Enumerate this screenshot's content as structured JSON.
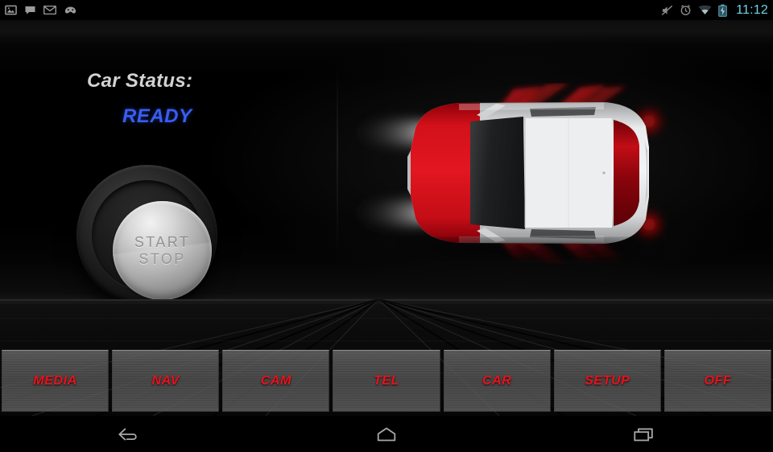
{
  "status_bar": {
    "left_icons": [
      {
        "name": "screenshot-image-icon",
        "label": "screenshot"
      },
      {
        "name": "chat-bubble-icon",
        "label": "message"
      },
      {
        "name": "email-envelope-icon",
        "label": "email"
      },
      {
        "name": "cyanogenmod-head-icon",
        "label": "cyanogenmod"
      }
    ],
    "right_icons": [
      {
        "name": "volume-mute-icon",
        "label": "silent mode"
      },
      {
        "name": "alarm-clock-icon",
        "label": "alarm set"
      },
      {
        "name": "wifi-icon",
        "label": "wifi"
      },
      {
        "name": "battery-charging-icon",
        "label": "battery charging"
      }
    ],
    "clock": "11:12",
    "clock_color": "#6fd5e8"
  },
  "main": {
    "car_status_label": "Car Status:",
    "car_status_value": "READY",
    "car_status_value_color": "#3a5cf0",
    "start_stop": {
      "line1": "START",
      "line2": "STOP"
    },
    "car_visual": {
      "name": "car-top-view",
      "body_color": "#d9dbdc",
      "hood_color": "#cc0f16",
      "windshield_color": "#2a2b2d",
      "taillight_color": "#e00a12",
      "headlight_beam_color": "#ffffff",
      "indicator_beam_color": "#d4141c"
    }
  },
  "button_bar": {
    "label_color": "#e8121b",
    "buttons": [
      {
        "name": "media-button",
        "label": "MEDIA"
      },
      {
        "name": "nav-button",
        "label": "NAV"
      },
      {
        "name": "cam-button",
        "label": "CAM"
      },
      {
        "name": "tel-button",
        "label": "TEL"
      },
      {
        "name": "car-button",
        "label": "CAR"
      },
      {
        "name": "setup-button",
        "label": "SETUP"
      },
      {
        "name": "off-button",
        "label": "OFF"
      }
    ]
  },
  "nav_bar": {
    "buttons": [
      {
        "name": "back-icon",
        "label": "Back"
      },
      {
        "name": "home-icon",
        "label": "Home"
      },
      {
        "name": "recents-icon",
        "label": "Recent apps"
      }
    ]
  }
}
